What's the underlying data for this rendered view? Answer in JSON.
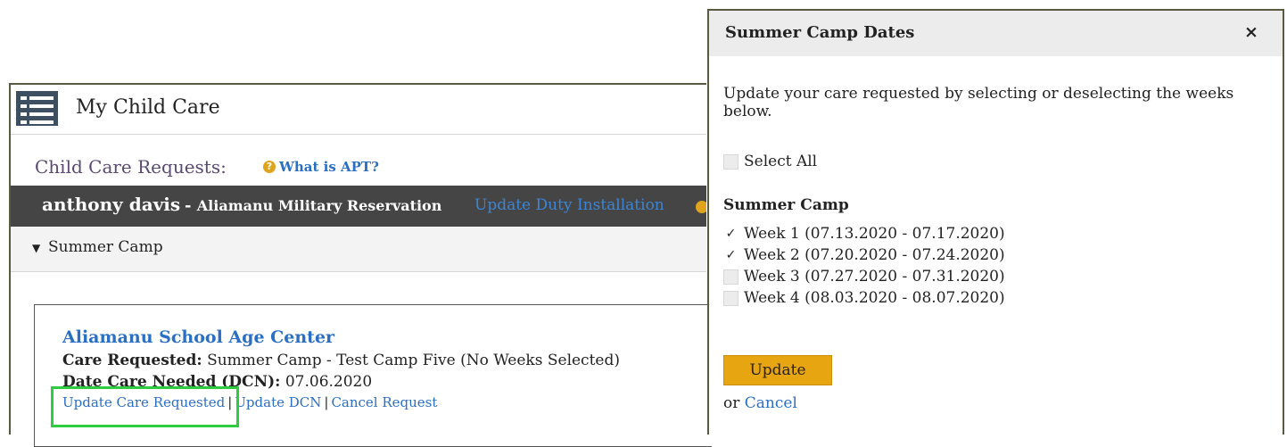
{
  "left": {
    "title": "My Child Care",
    "requests_label": "Child Care Requests:",
    "apt_link": "What is APT?",
    "user_name": "anthony davis",
    "installation": "Aliamanu Military Reservation",
    "installation_sep": " - ",
    "update_duty": "Update Duty Installation",
    "category": "Summer Camp",
    "card": {
      "center": "Aliamanu School Age Center",
      "care_label": "Care Requested:",
      "care_value": "Summer Camp - Test Camp Five (No Weeks Selected)",
      "dcn_label": "Date Care Needed (DCN):",
      "dcn_value": "07.06.2020",
      "links": [
        "Update Care Requested",
        "Update DCN",
        "Cancel Request"
      ],
      "sep": "|"
    }
  },
  "modal": {
    "title": "Summer Camp Dates",
    "close": "×",
    "description": "Update your care requested by selecting or deselecting the weeks below.",
    "select_all": "Select All",
    "section": "Summer Camp",
    "weeks": [
      {
        "label": "Week 1 (07.13.2020 - 07.17.2020)",
        "checked": true
      },
      {
        "label": "Week 2 (07.20.2020 - 07.24.2020)",
        "checked": true
      },
      {
        "label": "Week 3 (07.27.2020 - 07.31.2020)",
        "checked": false
      },
      {
        "label": "Week 4 (08.03.2020 - 08.07.2020)",
        "checked": false
      }
    ],
    "update_button": "Update",
    "or_text": "or",
    "cancel_link": "Cancel"
  },
  "colors": {
    "link": "#2a6fc4",
    "name_bar": "#454545",
    "button": "#e7a511",
    "highlight": "#2ecc40"
  },
  "icons": [
    "list-icon",
    "help-icon",
    "caret-down-icon",
    "close-icon",
    "check-icon"
  ]
}
